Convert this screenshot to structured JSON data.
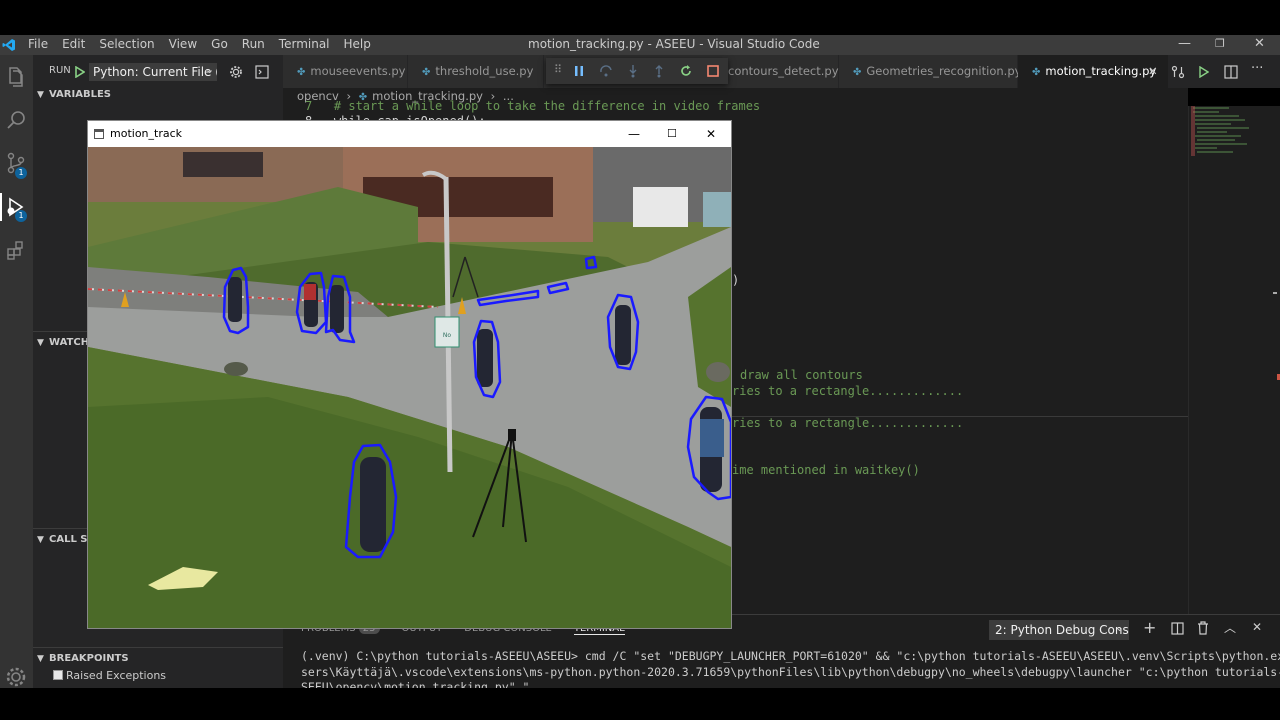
{
  "window": {
    "menu": [
      "File",
      "Edit",
      "Selection",
      "View",
      "Go",
      "Run",
      "Terminal",
      "Help"
    ],
    "title": "motion_tracking.py - ASEEU - Visual Studio Code"
  },
  "activity": {
    "icons": [
      "files-icon",
      "search-icon",
      "source-control-icon",
      "debug-icon",
      "extensions-icon",
      "settings-gear-icon"
    ],
    "badges": [
      "1",
      "1"
    ]
  },
  "run": {
    "label": "RUN",
    "config": "Python: Current File (Ir"
  },
  "sidebar": {
    "sections": [
      "VARIABLES",
      "WATCH",
      "CALL STA",
      "BREAKPOINTS"
    ],
    "breakpoint_item": "Raised Exceptions"
  },
  "tabs": [
    {
      "label": "mouseevents.py"
    },
    {
      "label": "threshold_use.py"
    },
    {
      "label": "contours_detect.py"
    },
    {
      "label": "Geometries_recognition.py"
    },
    {
      "label": "motion_tracking.py"
    }
  ],
  "breadcrumb": {
    "folder": "opencv",
    "file": "motion_tracking.py",
    "more": "..."
  },
  "code": {
    "line_a": "7   # start a while loop to take the difference in video frames",
    "line_b": "8   while cap.isOpened():",
    "frag1": ")",
    "frag2": "draw all contours",
    "frag3": "ries to a rectangle.............",
    "frag4": "ries to a rectangle.............",
    "frag5": "ime mentioned in waitkey()"
  },
  "panel": {
    "tabs": [
      "PROBLEMS",
      "OUTPUT",
      "DEBUG CONSOLE",
      "TERMINAL"
    ],
    "problems_count": "25",
    "terminal_select": "2: Python Debug Consc",
    "terminal_text": "(.venv) C:\\python tutorials-ASEEU\\ASEEU> cmd /C \"set \"DEBUGPY_LAUNCHER_PORT=61020\" && \"c:\\python tutorials-ASEEU\\ASEEU\\.venv\\Scripts\\python.exe\" c:\\U\nsers\\Käyttäjä\\.vscode\\extensions\\ms-python.python-2020.3.71659\\pythonFiles\\lib\\python\\debugpy\\no_wheels\\debugpy\\launcher \"c:\\python tutorials-ASEEU\\A\nSEEU\\opencv\\motion_tracking.py\" \""
  },
  "cv_window": {
    "title": "motion_track",
    "sign_text": "No"
  },
  "colors": {
    "accent": "#007acc",
    "contour": "#1a1aff",
    "reload": "#89d185",
    "stop": "#f48771"
  }
}
